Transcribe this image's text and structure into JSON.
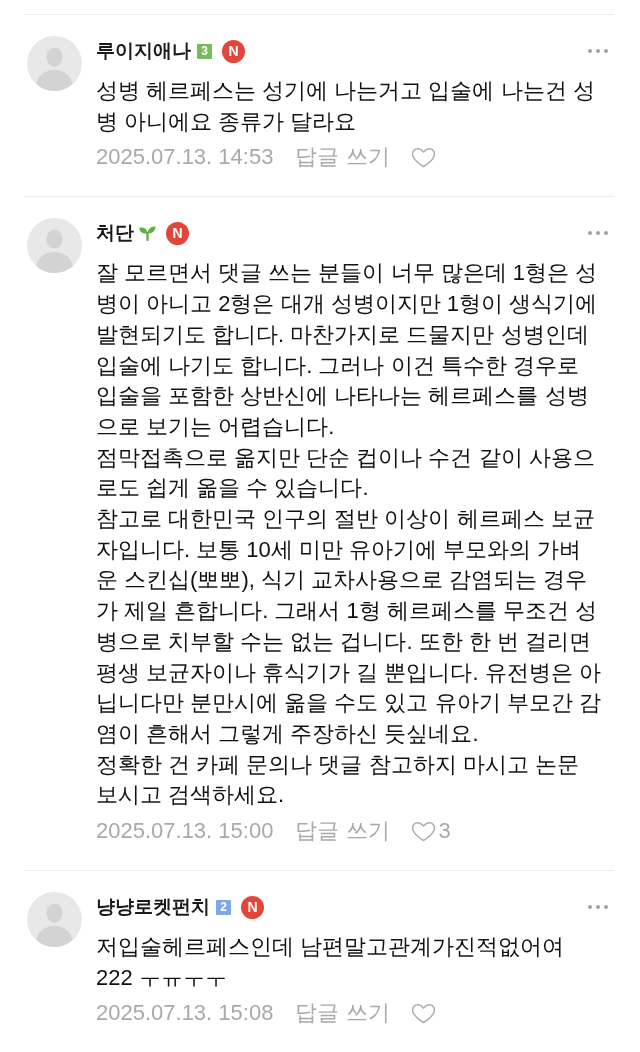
{
  "comments": [
    {
      "author": "루이지애나",
      "grade": {
        "kind": "number",
        "label": "3",
        "color": "#78bb5f"
      },
      "badge": "N",
      "text": "성병 헤르페스는 성기에 나는거고 입술에 나는건 성병 아니에요 종류가 달라요",
      "date": "2025.07.13. 14:53",
      "reply_label": "답글 쓰기",
      "liked": false
    },
    {
      "author": "처단",
      "grade": {
        "kind": "sprout"
      },
      "badge": "N",
      "text": "잘 모르면서 댓글 쓰는 분들이 너무 많은데 1형은 성병이 아니고 2형은 대개 성병이지만 1형이 생식기에 발현되기도 합니다. 마찬가지로 드물지만 성병인데 입술에 나기도 합니다. 그러나 이건 특수한 경우로 입술을 포함한 상반신에 나타나는 헤르페스를 성병으로 보기는 어렵습니다.\n점막접촉으로 옮지만 단순 컵이나 수건 같이 사용으로도 쉽게 옮을 수 있습니다.\n참고로 대한민국 인구의 절반 이상이 헤르페스 보균자입니다. 보통 10세 미만 유아기에 부모와의 가벼운 스킨십(뽀뽀), 식기 교차사용으로 감염되는 경우가 제일 흔합니다. 그래서 1형 헤르페스를 무조건 성병으로 치부할 수는 없는 겁니다. 또한 한 번 걸리면 평생 보균자이나 휴식기가 길 뿐입니다. 유전병은 아닙니다만 분만시에 옮을 수도 있고 유아기 부모간 감염이 흔해서 그렇게 주장하신 듯싶네요.\n정확한 건 카페 문의나 댓글 참고하지 마시고 논문 보시고 검색하세요.",
      "date": "2025.07.13. 15:00",
      "reply_label": "답글 쓰기",
      "liked": false,
      "likes": "3"
    },
    {
      "author": "냥냥로켓펀치",
      "grade": {
        "kind": "number",
        "label": "2",
        "color": "#7fa7e6"
      },
      "badge": "N",
      "text": "저입술헤르페스인데 남편말고관계가진적없어여\n222 ㅜㅠㅜㅜ",
      "date": "2025.07.13. 15:08",
      "reply_label": "답글 쓰기",
      "liked": false
    }
  ]
}
